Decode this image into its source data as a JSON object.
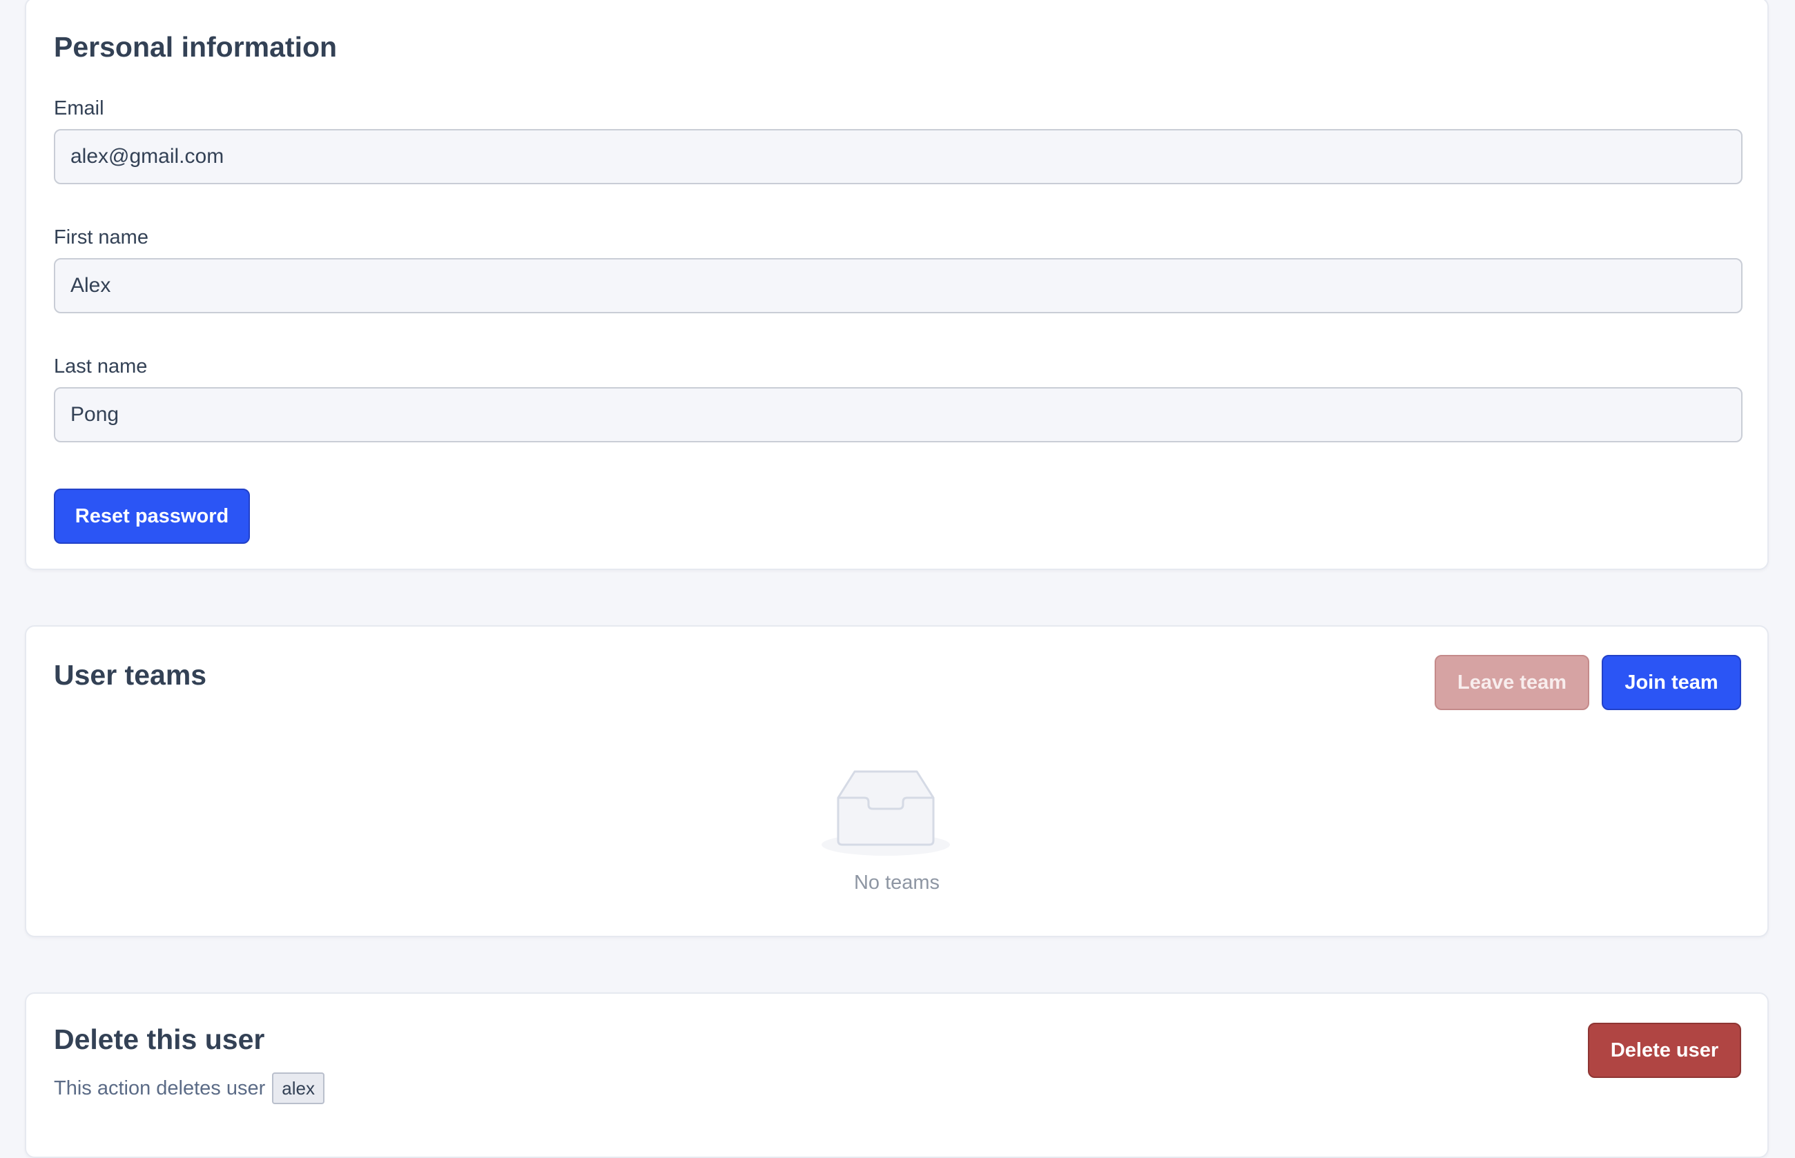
{
  "personal_information": {
    "title": "Personal information",
    "email": {
      "label": "Email",
      "value": "alex@gmail.com"
    },
    "first_name": {
      "label": "First name",
      "value": "Alex"
    },
    "last_name": {
      "label": "Last name",
      "value": "Pong"
    },
    "reset_password_label": "Reset password"
  },
  "user_teams": {
    "title": "User teams",
    "leave_team_label": "Leave team",
    "join_team_label": "Join team",
    "empty_text": "No teams"
  },
  "delete_user_section": {
    "title": "Delete this user",
    "description": "This action deletes user",
    "username": "alex",
    "delete_button_label": "Delete user"
  },
  "colors": {
    "primary": "#2b55f5",
    "leave_disabled": "#d6a3a3",
    "danger": "#b04543",
    "background": "#f5f6fa"
  },
  "icons": {
    "empty_state": "inbox-tray-icon"
  }
}
